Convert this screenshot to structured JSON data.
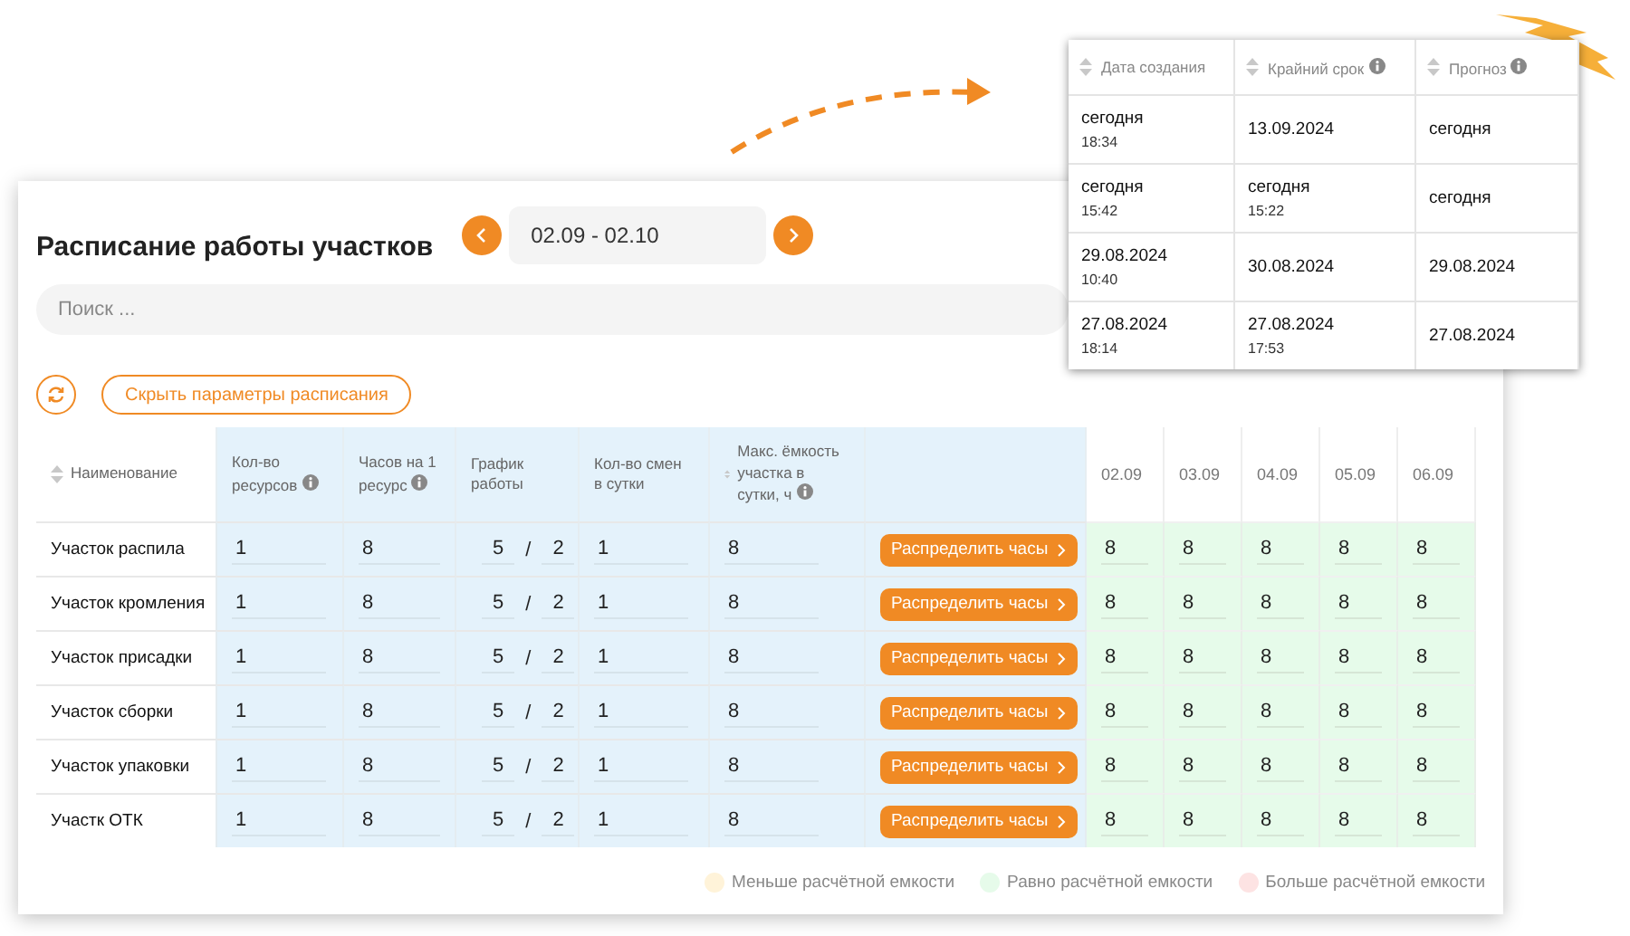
{
  "title": "Расписание работы участков",
  "date_range": {
    "label": "02.09 - 02.10"
  },
  "search": {
    "placeholder": "Поиск ..."
  },
  "hide_button": "Скрыть параметры расписания",
  "table": {
    "columns": [
      {
        "label": "Наименование",
        "sortable": true,
        "info": false,
        "kind": "name"
      },
      {
        "label": "Кол-во ресурсов",
        "sortable": false,
        "info": true,
        "kind": "param"
      },
      {
        "label": "Часов на 1 ресурс",
        "sortable": false,
        "info": true,
        "kind": "param"
      },
      {
        "label": "График работы",
        "sortable": false,
        "info": false,
        "kind": "param"
      },
      {
        "label": "Кол-во смен в сутки",
        "sortable": false,
        "info": false,
        "kind": "param"
      },
      {
        "label": "Макс. ёмкость участка в сутки, ч",
        "sortable": true,
        "info": true,
        "kind": "param"
      }
    ],
    "days": [
      "02.09",
      "03.09",
      "04.09",
      "05.09",
      "06.09"
    ],
    "rows": [
      {
        "name": "Участок распила",
        "resources": "1",
        "hours": "8",
        "schedule": {
          "work": "5",
          "separator": "/",
          "rest": "2"
        },
        "shifts": "1",
        "capacity": "8",
        "action": "Распределить часы",
        "days": [
          {
            "value": "8",
            "color": "#e6fbea"
          },
          {
            "value": "8",
            "color": "#e6fbea"
          },
          {
            "value": "8",
            "color": "#e6fbea"
          },
          {
            "value": "8",
            "color": "#e6fbea"
          },
          {
            "value": "8",
            "color": "#e6fbea"
          }
        ]
      },
      {
        "name": "Участок кромления",
        "resources": "1",
        "hours": "8",
        "schedule": {
          "work": "5",
          "separator": "/",
          "rest": "2"
        },
        "shifts": "1",
        "capacity": "8",
        "action": "Распределить часы",
        "days": [
          {
            "value": "8",
            "color": "#e6fbea"
          },
          {
            "value": "8",
            "color": "#e6fbea"
          },
          {
            "value": "8",
            "color": "#e6fbea"
          },
          {
            "value": "8",
            "color": "#e6fbea"
          },
          {
            "value": "8",
            "color": "#e6fbea"
          }
        ]
      },
      {
        "name": "Участок присадки",
        "resources": "1",
        "hours": "8",
        "schedule": {
          "work": "5",
          "separator": "/",
          "rest": "2"
        },
        "shifts": "1",
        "capacity": "8",
        "action": "Распределить часы",
        "days": [
          {
            "value": "8",
            "color": "#e6fbea"
          },
          {
            "value": "8",
            "color": "#e6fbea"
          },
          {
            "value": "8",
            "color": "#e6fbea"
          },
          {
            "value": "8",
            "color": "#e6fbea"
          },
          {
            "value": "8",
            "color": "#e6fbea"
          }
        ]
      },
      {
        "name": "Участок сборки",
        "resources": "1",
        "hours": "8",
        "schedule": {
          "work": "5",
          "separator": "/",
          "rest": "2"
        },
        "shifts": "1",
        "capacity": "8",
        "action": "Распределить часы",
        "days": [
          {
            "value": "8",
            "color": "#e6fbea"
          },
          {
            "value": "8",
            "color": "#e6fbea"
          },
          {
            "value": "8",
            "color": "#e6fbea"
          },
          {
            "value": "8",
            "color": "#e6fbea"
          },
          {
            "value": "8",
            "color": "#e6fbea"
          }
        ]
      },
      {
        "name": "Участок упаковки",
        "resources": "1",
        "hours": "8",
        "schedule": {
          "work": "5",
          "separator": "/",
          "rest": "2"
        },
        "shifts": "1",
        "capacity": "8",
        "action": "Распределить часы",
        "days": [
          {
            "value": "8",
            "color": "#e6fbea"
          },
          {
            "value": "8",
            "color": "#e6fbea"
          },
          {
            "value": "8",
            "color": "#e6fbea"
          },
          {
            "value": "8",
            "color": "#e6fbea"
          },
          {
            "value": "8",
            "color": "#e6fbea"
          }
        ]
      },
      {
        "name": "Участк ОТК",
        "resources": "1",
        "hours": "8",
        "schedule": {
          "work": "5",
          "separator": "/",
          "rest": "2"
        },
        "shifts": "1",
        "capacity": "8",
        "action": "Распределить часы",
        "days": [
          {
            "value": "8",
            "color": "#e6fbea"
          },
          {
            "value": "8",
            "color": "#e6fbea"
          },
          {
            "value": "8",
            "color": "#e6fbea"
          },
          {
            "value": "8",
            "color": "#e6fbea"
          },
          {
            "value": "8",
            "color": "#e6fbea"
          }
        ]
      }
    ]
  },
  "legend": [
    {
      "label": "Меньше расчётной емкости",
      "color": "#fff3d9"
    },
    {
      "label": "Равно расчётной емкости",
      "color": "#e6fbea"
    },
    {
      "label": "Больше расчётной емкости",
      "color": "#fde3e3"
    }
  ],
  "popup": {
    "columns": [
      {
        "label": "Дата создания",
        "sortable": true,
        "info": false
      },
      {
        "label": "Крайний срок",
        "sortable": true,
        "info": true
      },
      {
        "label": "Прогноз",
        "sortable": true,
        "info": true
      }
    ],
    "rows": [
      [
        {
          "date": "сегодня",
          "time": "18:34"
        },
        {
          "date": "13.09.2024"
        },
        {
          "date": "сегодня"
        }
      ],
      [
        {
          "date": "сегодня",
          "time": "15:42"
        },
        {
          "date": "сегодня",
          "time": "15:22"
        },
        {
          "date": "сегодня"
        }
      ],
      [
        {
          "date": "29.08.2024",
          "time": "10:40"
        },
        {
          "date": "30.08.2024"
        },
        {
          "date": "29.08.2024"
        }
      ],
      [
        {
          "date": "27.08.2024",
          "time": "18:14"
        },
        {
          "date": "27.08.2024",
          "time": "17:53"
        },
        {
          "date": "27.08.2024"
        }
      ]
    ]
  }
}
